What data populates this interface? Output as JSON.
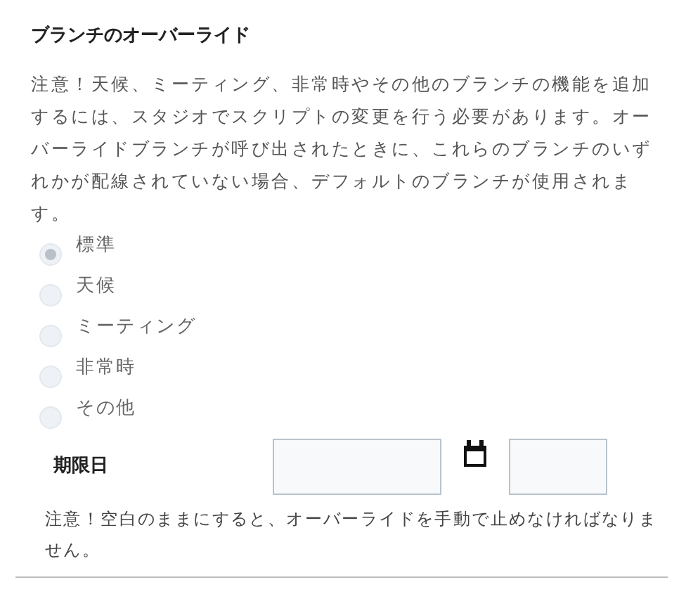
{
  "title": "ブランチのオーバーライド",
  "notice": "注意！天候、ミーティング、非常時やその他のブランチの機能を追加するには、スタジオでスクリプトの変更を行う必要があります。オーバーライドブランチが呼び出されたときに、これらのブランチのいずれかが配線されていない場合、デフォルトのブランチが使用されます。",
  "branches": [
    {
      "label": "標準",
      "selected": true,
      "disabled": true
    },
    {
      "label": "天候",
      "selected": false,
      "disabled": true
    },
    {
      "label": "ミーティング",
      "selected": false,
      "disabled": true
    },
    {
      "label": "非常時",
      "selected": false,
      "disabled": true
    },
    {
      "label": "その他",
      "selected": false,
      "disabled": true
    }
  ],
  "due_date": {
    "label": "期限日"
  },
  "blank_note": "注意！空白のままにすると、オーバーライドを手動で止めなければなりません。"
}
